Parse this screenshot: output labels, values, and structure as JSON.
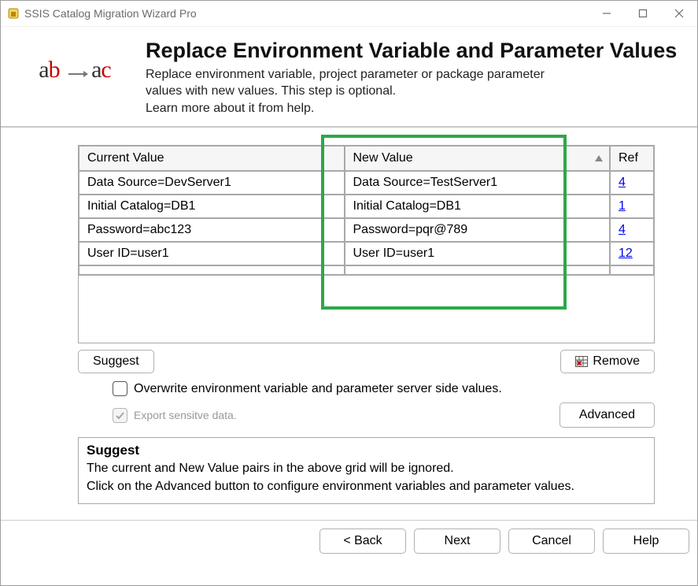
{
  "window": {
    "title": "SSIS Catalog Migration Wizard Pro"
  },
  "header": {
    "title": "Replace Environment Variable and Parameter Values",
    "desc_line1": "Replace environment variable, project parameter or package parameter",
    "desc_line2": "values with new values. This step is optional.",
    "desc_line3": "Learn more about it from help."
  },
  "grid": {
    "columns": {
      "current": "Current Value",
      "new": "New Value",
      "ref": "Ref"
    },
    "rows": [
      {
        "current": "Data Source=DevServer1",
        "new": "Data Source=TestServer1",
        "ref": "4"
      },
      {
        "current": "Initial Catalog=DB1",
        "new": "Initial Catalog=DB1",
        "ref": "1"
      },
      {
        "current": "Password=abc123",
        "new": "Password=pqr@789",
        "ref": "4"
      },
      {
        "current": "User ID=user1",
        "new": "User ID=user1",
        "ref": "12"
      }
    ]
  },
  "buttons": {
    "suggest": "Suggest",
    "remove": "Remove",
    "advanced": "Advanced",
    "back": "< Back",
    "next": "Next",
    "cancel": "Cancel",
    "help": "Help"
  },
  "checks": {
    "overwrite": "Overwrite environment variable and parameter server side values.",
    "export_sensitive": "Export sensitve data."
  },
  "info": {
    "title": "Suggest",
    "line1": "The current and New Value pairs in the above grid will be ignored.",
    "line2": "Click on the Advanced button to configure environment variables and parameter values."
  }
}
